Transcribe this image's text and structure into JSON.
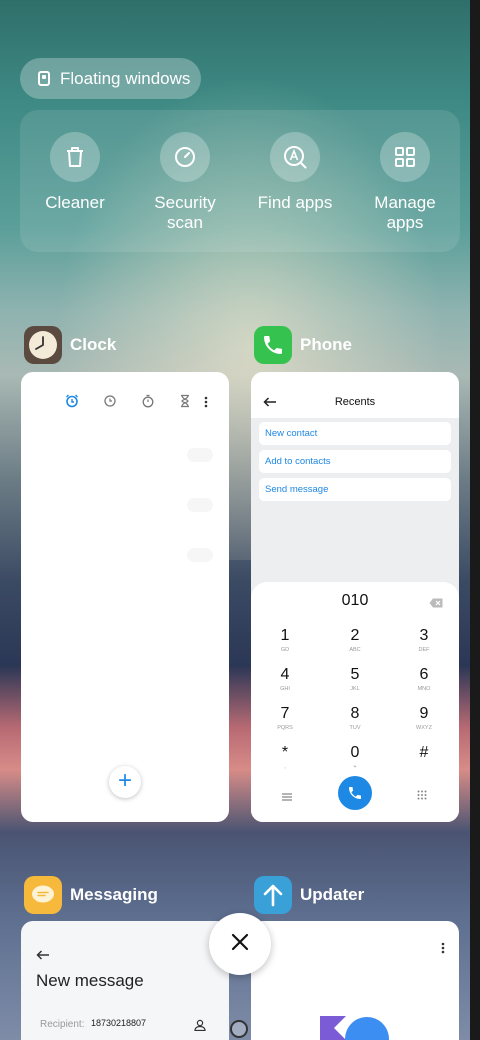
{
  "floating_windows": {
    "label": "Floating windows",
    "icon": "floating-window-icon"
  },
  "quick_actions": [
    {
      "label": "Cleaner",
      "icon": "trash-icon"
    },
    {
      "label": "Security scan",
      "icon": "security-scan-icon"
    },
    {
      "label": "Find apps",
      "icon": "find-apps-icon"
    },
    {
      "label": "Manage apps",
      "icon": "grid-icon"
    }
  ],
  "apps": {
    "clock": {
      "name": "Clock",
      "icon": "clock-icon",
      "accent": "#1e88e5"
    },
    "phone": {
      "name": "Phone",
      "icon": "phone-icon",
      "accent": "#36c24f",
      "title": "Recents",
      "options": [
        "New contact",
        "Add to contacts",
        "Send message"
      ],
      "number": "010",
      "keys": [
        {
          "n": "1",
          "l": "GD"
        },
        {
          "n": "2",
          "l": "ABC"
        },
        {
          "n": "3",
          "l": "DEF"
        },
        {
          "n": "4",
          "l": "GHI"
        },
        {
          "n": "5",
          "l": "JKL"
        },
        {
          "n": "6",
          "l": "MNO"
        },
        {
          "n": "7",
          "l": "PQRS"
        },
        {
          "n": "8",
          "l": "TUV"
        },
        {
          "n": "9",
          "l": "WXYZ"
        },
        {
          "n": "*",
          "l": ","
        },
        {
          "n": "0",
          "l": "+"
        },
        {
          "n": "#",
          "l": ""
        }
      ]
    },
    "messaging": {
      "name": "Messaging",
      "icon": "message-icon",
      "accent": "#f6b93b",
      "title": "New message",
      "recipient_label": "Recipient:",
      "recipient_value": "18730218807"
    },
    "updater": {
      "name": "Updater",
      "icon": "arrow-up-icon",
      "accent": "#3aa0d8"
    }
  },
  "close_all": {
    "icon": "close-icon"
  }
}
